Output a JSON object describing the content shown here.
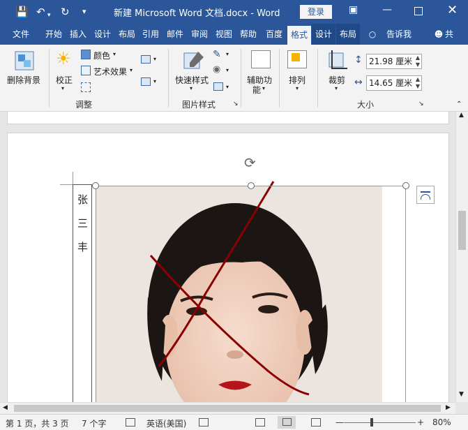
{
  "title_bar": {
    "document_title": "新建 Microsoft Word 文档.docx - Word",
    "login_label": "登录",
    "icons": [
      "save-icon",
      "undo-icon",
      "redo-icon",
      "customize-qat-icon",
      "ribbon-display-icon",
      "minimize-icon",
      "maximize-icon",
      "close-icon"
    ]
  },
  "tabs": [
    {
      "label": "文件"
    },
    {
      "label": "开始"
    },
    {
      "label": "插入"
    },
    {
      "label": "设计"
    },
    {
      "label": "布局"
    },
    {
      "label": "引用"
    },
    {
      "label": "邮件"
    },
    {
      "label": "审阅"
    },
    {
      "label": "视图"
    },
    {
      "label": "帮助"
    },
    {
      "label": "百度"
    },
    {
      "label": "格式"
    },
    {
      "label": "设计"
    },
    {
      "label": "布局"
    },
    {
      "label": "告诉我"
    },
    {
      "label": "共"
    }
  ],
  "ribbon": {
    "remove_bg": "删除背景",
    "corrections": "校正",
    "color": "颜色",
    "artistic_effects": "艺术效果",
    "adjust_group": "调整",
    "quick_styles": "快速样式",
    "picture_styles_group": "图片样式",
    "accessibility_line1": "辅助功",
    "accessibility_line2": "能",
    "arrange": "排列",
    "crop": "裁剪",
    "height_value": "21.98 厘米",
    "width_value": "14.65 厘米",
    "size_group": "大小"
  },
  "document": {
    "text_box_chars": [
      "张",
      "三",
      "丰"
    ]
  },
  "status_bar": {
    "page": "第 1 页，共 3 页",
    "words": "7 个字",
    "language": "英语(美国)",
    "zoom": "80%",
    "zoom_level": 0.8
  },
  "colors": {
    "title_blue": "#2b579a",
    "ribbon_bg": "#f3f3f3",
    "annotation_red": "#8b0000"
  }
}
